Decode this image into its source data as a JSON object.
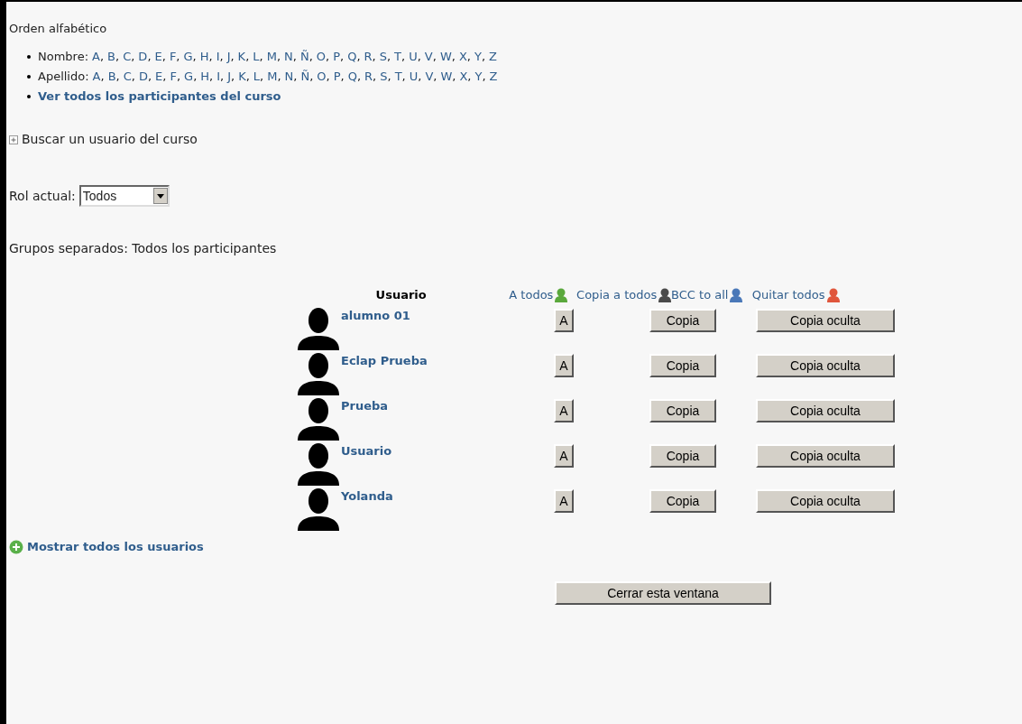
{
  "heading": "Orden alfabético",
  "filters": [
    {
      "label": "Nombre:",
      "separator": ",",
      "letters": [
        "A",
        "B",
        "C",
        "D",
        "E",
        "F",
        "G",
        "H",
        "I",
        "J",
        "K",
        "L",
        "M",
        "N",
        "Ñ",
        "O",
        "P",
        "Q",
        "R",
        "S",
        "T",
        "U",
        "V",
        "W",
        "X",
        "Y",
        "Z"
      ]
    },
    {
      "label": "Apellido:",
      "separator": ",",
      "letters": [
        "A",
        "B",
        "C",
        "D",
        "E",
        "F",
        "G",
        "H",
        "I",
        "J",
        "K",
        "L",
        "M",
        "N",
        "Ñ",
        "O",
        "P",
        "Q",
        "R",
        "S",
        "T",
        "U",
        "V",
        "W",
        "X",
        "Y",
        "Z"
      ]
    }
  ],
  "all_participants_link": "Ver todos los participantes del curso",
  "search_toggle": {
    "label": "Buscar un usuario del curso",
    "expanded": false
  },
  "role": {
    "label": "Rol actual:",
    "value": "Todos"
  },
  "groups": "Grupos separados: Todos los participantes",
  "table": {
    "columns": [
      {
        "label": "Usuario",
        "kind": "plain"
      },
      {
        "label": "A todos",
        "kind": "link",
        "color": "#5aa83c"
      },
      {
        "label": "Copia a todos",
        "kind": "link",
        "color": "#4a4a4a"
      },
      {
        "label": "BCC to all",
        "kind": "link",
        "color": "#4a78b8"
      },
      {
        "label": "Quitar todos",
        "kind": "link",
        "color": "#e0563c"
      }
    ],
    "rows": [
      {
        "name": "alumno 01",
        "to": "A",
        "cc": "Copia",
        "bcc": "Copia oculta"
      },
      {
        "name": "Eclap Prueba",
        "to": "A",
        "cc": "Copia",
        "bcc": "Copia oculta"
      },
      {
        "name": "Prueba",
        "to": "A",
        "cc": "Copia",
        "bcc": "Copia oculta"
      },
      {
        "name": "Usuario",
        "to": "A",
        "cc": "Copia",
        "bcc": "Copia oculta"
      },
      {
        "name": "Yolanda",
        "to": "A",
        "cc": "Copia",
        "bcc": "Copia oculta"
      }
    ]
  },
  "show_all_link": "Mostrar todos los usuarios",
  "close_button": "Cerrar esta ventana"
}
